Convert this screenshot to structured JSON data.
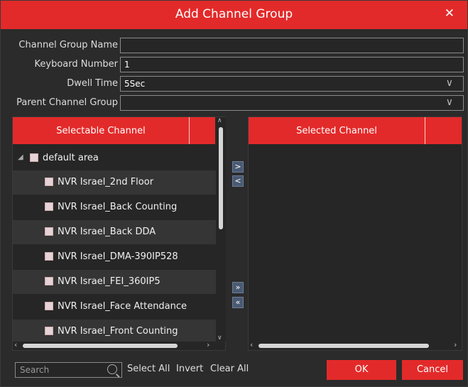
{
  "dialog": {
    "title": "Add Channel Group",
    "close_glyph": "✕"
  },
  "form": {
    "group_name_label": "Channel Group Name",
    "group_name_value": "",
    "keyboard_label": "Keyboard Number",
    "keyboard_value": "1",
    "dwell_label": "Dwell Time",
    "dwell_value": "5Sec",
    "parent_label": "Parent Channel Group",
    "parent_value": ""
  },
  "left_panel": {
    "header": "Selectable Channel",
    "root": "default area",
    "channels": [
      "NVR Israel_2nd Floor",
      "NVR Israel_Back Counting",
      "NVR Israel_Back DDA",
      "NVR Israel_DMA-390IP528",
      "NVR Israel_FEI_360IP5",
      "NVR Israel_Face Attendance",
      "NVR Israel_Front Counting"
    ]
  },
  "right_panel": {
    "header": "Selected Channel"
  },
  "move_buttons": {
    "add": ">",
    "remove": "<",
    "add_all": "»",
    "remove_all": "«"
  },
  "footer": {
    "search_placeholder": "Search",
    "select_all": "Select All",
    "invert": "Invert",
    "clear_all": "Clear All",
    "ok": "OK",
    "cancel": "Cancel"
  },
  "colors": {
    "accent": "#e32a2a",
    "background": "#2b2b2b"
  }
}
